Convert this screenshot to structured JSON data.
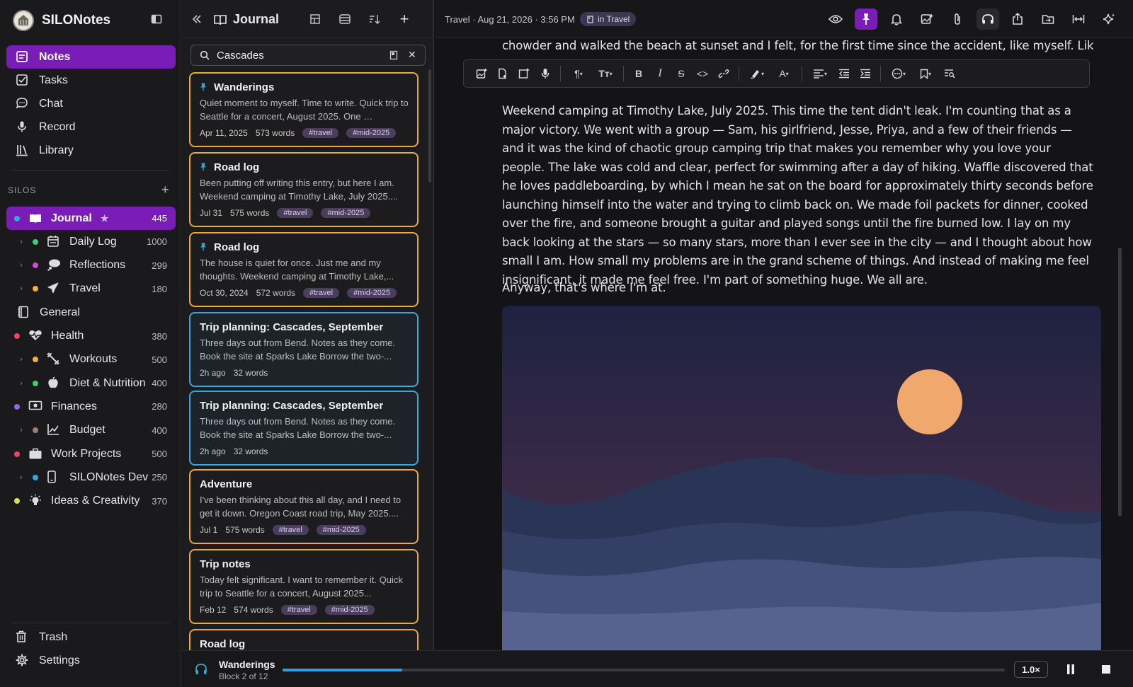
{
  "app": {
    "name": "SILONotes"
  },
  "nav": [
    {
      "label": "Notes",
      "icon": "notes-icon",
      "active": true
    },
    {
      "label": "Tasks",
      "icon": "tasks-icon"
    },
    {
      "label": "Chat",
      "icon": "chat-icon"
    },
    {
      "label": "Record",
      "icon": "microphone-icon"
    },
    {
      "label": "Library",
      "icon": "library-icon"
    }
  ],
  "silos_header": "SILOS",
  "silos": [
    {
      "label": "Journal",
      "count": "445",
      "dot": "#3aa6de",
      "icon": "book-icon",
      "active": true,
      "starred": true
    },
    {
      "label": "Daily Log",
      "count": "1000",
      "dot": "#3ccf7a",
      "icon": "calendar-icon",
      "child": true
    },
    {
      "label": "Reflections",
      "count": "299",
      "dot": "#d04bd0",
      "icon": "thought-icon",
      "child": true
    },
    {
      "label": "Travel",
      "count": "180",
      "dot": "#f0b43a",
      "icon": "plane-icon",
      "child": true
    },
    {
      "label": "General",
      "count": "",
      "dot": "",
      "icon": "notebook-icon"
    },
    {
      "label": "Health",
      "count": "380",
      "dot": "#ee4466",
      "icon": "heartbeat-icon"
    },
    {
      "label": "Workouts",
      "count": "500",
      "dot": "#f0b43a",
      "icon": "dumbbell-icon",
      "child": true
    },
    {
      "label": "Diet & Nutrition",
      "count": "400",
      "dot": "#3ccf7a",
      "icon": "apple-icon",
      "child": true
    },
    {
      "label": "Finances",
      "count": "280",
      "dot": "#8a6ae0",
      "icon": "money-icon"
    },
    {
      "label": "Budget",
      "count": "400",
      "dot": "#a08070",
      "icon": "chart-line-icon",
      "child": true
    },
    {
      "label": "Work Projects",
      "count": "500",
      "dot": "#ee4466",
      "icon": "briefcase-icon"
    },
    {
      "label": "SILONotes Dev",
      "count": "250",
      "dot": "#3aa6de",
      "icon": "phone-icon",
      "child": true
    },
    {
      "label": "Ideas & Creativity",
      "count": "370",
      "dot": "#d8e050",
      "icon": "lightbulb-icon"
    }
  ],
  "bottom_nav": [
    {
      "label": "Trash",
      "icon": "trash-icon"
    },
    {
      "label": "Settings",
      "icon": "gear-icon"
    }
  ],
  "list": {
    "title": "Journal",
    "search_value": "Cascades",
    "notes": [
      {
        "title": "Wanderings",
        "pinned": true,
        "body": "Quiet moment to myself. Time to write. Quick trip to Seattle for a concert, August 2025. One …",
        "date": "Apr 11, 2025",
        "words": "573 words",
        "tags": [
          "#travel",
          "#mid-2025"
        ],
        "selected": false
      },
      {
        "title": "Road log",
        "pinned": true,
        "body": "Been putting off writing this entry, but here I am. Weekend camping at Timothy Lake, July 2025....",
        "date": "Jul 31",
        "words": "575 words",
        "tags": [
          "#travel",
          "#mid-2025"
        ],
        "selected": false
      },
      {
        "title": "Road log",
        "pinned": true,
        "body": "The house is quiet for once. Just me and my thoughts. Weekend camping at Timothy Lake,...",
        "date": "Oct 30, 2024",
        "words": "572 words",
        "tags": [
          "#travel",
          "#mid-2025"
        ],
        "selected": false
      },
      {
        "title": "Trip planning: Cascades, September",
        "pinned": false,
        "body": "Three days out from Bend. Notes as they come. Book the site at Sparks Lake Borrow the two-...",
        "date": "2h ago",
        "words": "32 words",
        "tags": [],
        "selected": true
      },
      {
        "title": "Trip planning: Cascades, September",
        "pinned": false,
        "body": "Three days out from Bend. Notes as they come. Book the site at Sparks Lake Borrow the two-...",
        "date": "2h ago",
        "words": "32 words",
        "tags": [],
        "selected": true
      },
      {
        "title": "Adventure",
        "pinned": false,
        "body": "I've been thinking about this all day, and I need to get it down. Oregon Coast road trip, May 2025....",
        "date": "Jul 1",
        "words": "575 words",
        "tags": [
          "#travel",
          "#mid-2025"
        ],
        "selected": false
      },
      {
        "title": "Trip notes",
        "pinned": false,
        "body": "Today felt significant. I want to remember it. Quick trip to Seattle for a concert, August 2025...",
        "date": "Feb 12",
        "words": "574 words",
        "tags": [
          "#travel",
          "#mid-2025"
        ],
        "selected": false
      },
      {
        "title": "Road log",
        "pinned": false,
        "body": "",
        "date": "",
        "words": "",
        "tags": [],
        "selected": false
      }
    ]
  },
  "editor": {
    "breadcrumb": "Travel · Aug 21, 2026 · 3:56 PM",
    "badge": "in Travel",
    "para_top": "chowder and walked the beach at sunset and I felt, for the first time since the accident, like myself. Like the old",
    "para_main": "Weekend camping at Timothy Lake, July 2025. This time the tent didn't leak. I'm counting that as a major victory. We went with a group — Sam, his girlfriend, Jesse, Priya, and a few of their friends — and it was the kind of chaotic group camping trip that makes you remember why you love your people. The lake was cold and clear, perfect for swimming after a day of hiking. Waffle discovered that he loves paddleboarding, by which I mean he sat on the board for approximately thirty seconds before launching himself into the water and trying to climb back on. We made foil packets for dinner, cooked over the fire, and someone brought a guitar and played songs until the fire burned low. I lay on my back looking at the stars — so many stars, more than I ever see in the city — and I thought about how small I am. How small my problems are in the grand scheme of things. And instead of making me feel insignificant, it made me feel free. I'm part of something huge. We all are.",
    "para_end": "Anyway, that's where I'm at."
  },
  "player": {
    "title": "Wanderings",
    "subtitle": "Block 2 of 12",
    "progress": 0.166,
    "speed": "1.0×"
  },
  "colors": {
    "accent": "#7a1db6",
    "card_border": "#eaa93c",
    "selected_border": "#3aa6de"
  }
}
